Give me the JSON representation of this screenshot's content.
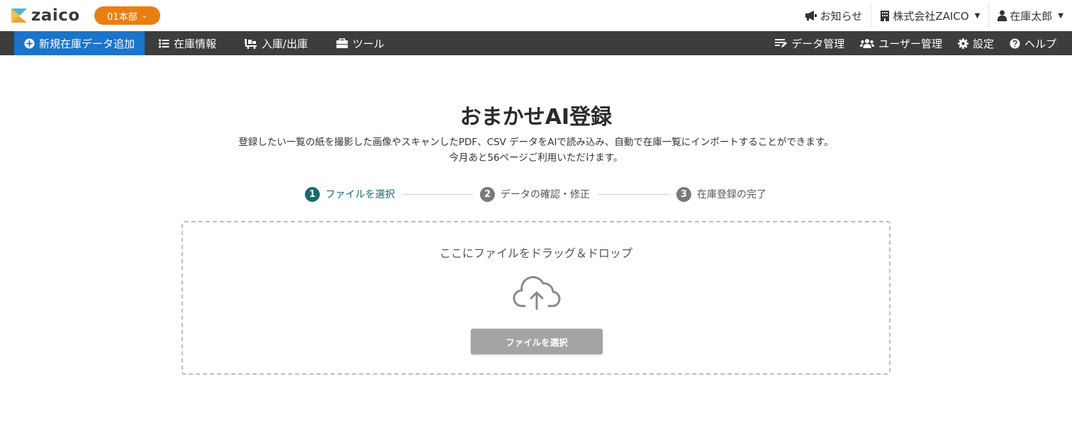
{
  "header": {
    "logo_text": "zaico",
    "branch_label": "01本部",
    "notice_label": "お知らせ",
    "company_label": "株式会社ZAICO",
    "user_label": "在庫太郎"
  },
  "nav": {
    "left": [
      {
        "label": "新規在庫データ追加",
        "icon": "plus-circle-icon"
      },
      {
        "label": "在庫情報",
        "icon": "list-icon"
      },
      {
        "label": "入庫/出庫",
        "icon": "cart-icon"
      },
      {
        "label": "ツール",
        "icon": "toolbox-icon"
      }
    ],
    "right": [
      {
        "label": "データ管理",
        "icon": "data-edit-icon"
      },
      {
        "label": "ユーザー管理",
        "icon": "users-icon"
      },
      {
        "label": "設定",
        "icon": "gear-icon"
      },
      {
        "label": "ヘルプ",
        "icon": "question-circle-icon"
      }
    ]
  },
  "main": {
    "title": "おまかせAI登録",
    "description_line1": "登録したい一覧の紙を撮影した画像やスキャンしたPDF、CSV データをAIで読み込み、自動で在庫一覧にインポートすることができます。",
    "description_line2": "今月あと56ページご利用いただけます。",
    "steps": [
      {
        "num": "1",
        "label": "ファイルを選択",
        "state": "active"
      },
      {
        "num": "2",
        "label": "データの確認・修正",
        "state": "inactive"
      },
      {
        "num": "3",
        "label": "在庫登録の完了",
        "state": "inactive"
      }
    ],
    "dropzone": {
      "label": "ここにファイルをドラッグ＆ドロップ",
      "button_label": "ファイルを選択"
    }
  },
  "colors": {
    "brand_orange": "#e87f12",
    "nav_bg": "#3d3d3d",
    "primary_blue": "#1b74c9",
    "step_active": "#1a6a72"
  }
}
